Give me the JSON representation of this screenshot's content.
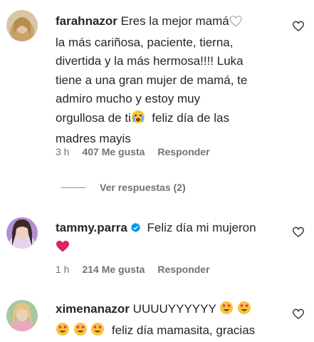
{
  "comments": [
    {
      "username": "farahnazor",
      "text_parts": [
        "Eres la mejor mamá",
        " \nla más cariñosa, paciente, tierna,\ndivertida y la más hermosa!!!! Luka\ntiene a una gran mujer de mamá, te\nadmiro mucho y estoy muy\norgullosa de ti",
        "  feliz día de las\nmadres mayis"
      ],
      "time": "3 h",
      "likes": "407 Me gusta",
      "reply": "Responder"
    },
    {
      "username": "tammy.parra",
      "text": "Feliz día mi mujeron",
      "time": "1 h",
      "likes": "214 Me gusta",
      "reply": "Responder"
    },
    {
      "username": "ximenanazor",
      "text_line1": "UUUUYYYYYY",
      "text_line2": "feliz día mamasita, gracias"
    }
  ],
  "view_replies": "Ver respuestas (2)",
  "icons": {
    "like": "heart-outline-icon",
    "verified": "verified-badge-icon",
    "accent_verified": "#0095f6",
    "red_heart": "#e0245e"
  }
}
